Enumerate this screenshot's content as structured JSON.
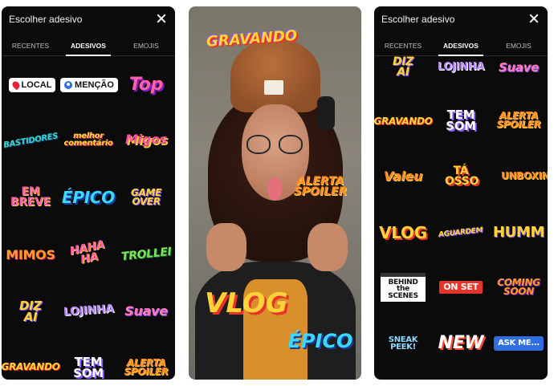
{
  "panel_left": {
    "title": "Escolher adesivo",
    "tabs": [
      "RECENTES",
      "ADESIVOS",
      "EMOJIS"
    ],
    "active_tab": "ADESIVOS",
    "stickers": [
      {
        "label": "LOCAL",
        "kind": "pill",
        "icon": "location-pin-icon"
      },
      {
        "label": "MENÇÃO",
        "kind": "pill",
        "icon": "mention-icon"
      },
      {
        "label": "Top",
        "color": "#ff5fa8"
      },
      {
        "label": "BASTIDORES",
        "color": "#39d4c8"
      },
      {
        "label": "melhor comentário",
        "color": "#ffd23a"
      },
      {
        "label": "Migos",
        "color": "#ff4fa0"
      },
      {
        "label": "EM BREVE",
        "color": "#ff5fa8"
      },
      {
        "label": "ÉPICO",
        "color": "#3ad7ff"
      },
      {
        "label": "GAME OVER",
        "color": "#ffd23a"
      },
      {
        "label": "MIMOS",
        "color": "#ff9a2a"
      },
      {
        "label": "HAHA HA",
        "color": "#ff5fa8"
      },
      {
        "label": "TROLLEI",
        "color": "#7be35a"
      },
      {
        "label": "DIZ AÍ",
        "color": "#ffd23a"
      },
      {
        "label": "LOJINHA",
        "color": "#b98cff"
      },
      {
        "label": "Suave",
        "color": "#ff7ab8"
      },
      {
        "label": "GRAVANDO",
        "color": "#ffd23a"
      },
      {
        "label": "TEM SOM",
        "color": "#8c5cff"
      },
      {
        "label": "ALERTA SPOILER",
        "color": "#ff8a2a"
      }
    ]
  },
  "panel_middle": {
    "overlays": [
      {
        "label": "GRAVANDO",
        "color": "#ffd23a"
      },
      {
        "label": "ALERTA SPOILER",
        "color": "#ff8a2a"
      },
      {
        "label": "VLOG",
        "color": "#ffd23a"
      },
      {
        "label": "ÉPICO",
        "color": "#3ad7ff"
      }
    ]
  },
  "panel_right": {
    "title": "Escolher adesivo",
    "tabs": [
      "RECENTES",
      "ADESIVOS",
      "EMOJIS"
    ],
    "active_tab": "ADESIVOS",
    "stickers": [
      {
        "label": "DIZ AÍ",
        "color": "#ffd23a"
      },
      {
        "label": "LOJINHA",
        "color": "#b98cff"
      },
      {
        "label": "Suave",
        "color": "#ff7ab8"
      },
      {
        "label": "GRAVANDO",
        "color": "#ffd23a"
      },
      {
        "label": "TEM SOM",
        "color": "#8c5cff"
      },
      {
        "label": "ALERTA SPOILER",
        "color": "#ff8a2a"
      },
      {
        "label": "Valeu",
        "color": "#ff8a2a"
      },
      {
        "label": "TÁ OSSO",
        "color": "#ffd23a"
      },
      {
        "label": "UNBOXING",
        "color": "#ff8a2a"
      },
      {
        "label": "VLOG",
        "color": "#ffd23a"
      },
      {
        "label": "AGUARDEM",
        "color": "#ffd23a"
      },
      {
        "label": "HUMM",
        "color": "#ffd23a"
      },
      {
        "label": "BEHIND the SCENES",
        "color": "#ffffff"
      },
      {
        "label": "ON SET",
        "color": "#e8332b"
      },
      {
        "label": "COMING SOON",
        "color": "#ff9a2a"
      },
      {
        "label": "SNEAK PEEK!",
        "color": "#8fd8ff"
      },
      {
        "label": "NEW",
        "color": "#ff4b2b"
      },
      {
        "label": "ASK ME...",
        "color": "#2f6fe0"
      }
    ]
  }
}
